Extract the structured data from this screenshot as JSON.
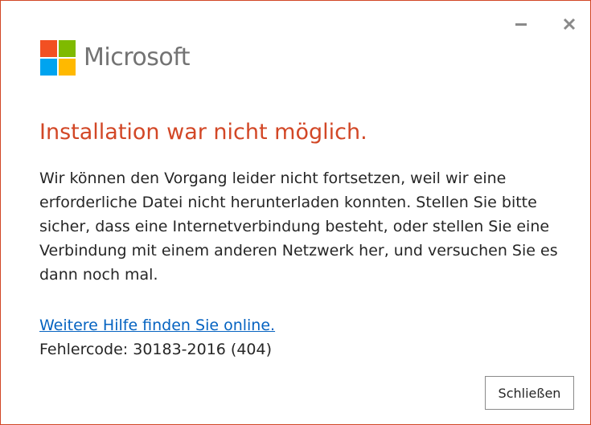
{
  "window": {
    "border_color": "#d24726"
  },
  "titlebar": {
    "minimize_icon": "minimize-icon",
    "close_icon": "close-icon"
  },
  "logo": {
    "text": "Microsoft",
    "colors": [
      "#f25022",
      "#7fba00",
      "#00a4ef",
      "#ffb900"
    ],
    "text_color": "#737373"
  },
  "dialog": {
    "title": "Installation war nicht möglich.",
    "title_color": "#d24726",
    "message": "Wir können den Vorgang leider nicht fortsetzen, weil wir eine erforderliche Datei nicht herunterladen konnten. Stellen Sie bitte sicher, dass eine Internetverbindung besteht, oder stellen Sie eine Verbindung mit einem anderen Netzwerk her, und versuchen Sie es dann noch mal.",
    "help_link": "Weitere Hilfe finden Sie online.",
    "link_color": "#0563c1",
    "error_code": "Fehlercode: 30183-2016 (404)"
  },
  "buttons": {
    "close_label": "Schließen"
  }
}
